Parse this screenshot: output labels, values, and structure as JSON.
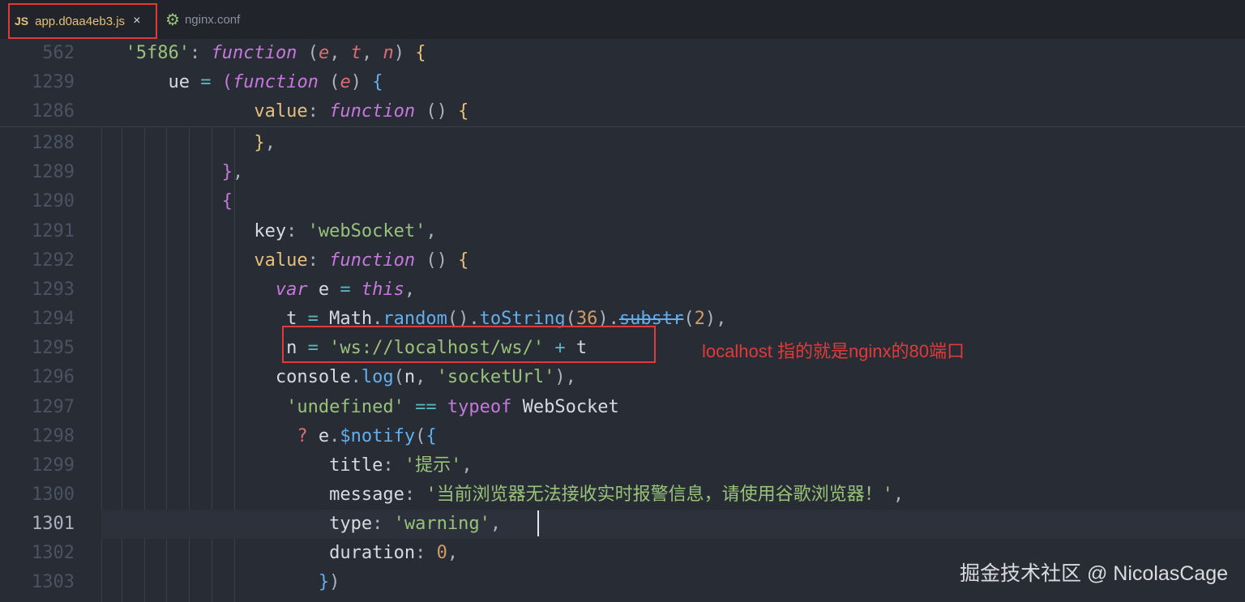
{
  "tabs": [
    {
      "icon": "JS",
      "label": "app.d0aa4eb3.js",
      "close": "×"
    },
    {
      "icon": "gear",
      "label": "nginx.conf"
    }
  ],
  "lines": [
    {
      "num": "562",
      "code": [
        [
          "s",
          "  '5f86'"
        ],
        [
          "p",
          ": "
        ],
        [
          "k",
          "function"
        ],
        [
          "p",
          " ("
        ],
        [
          "v",
          "e"
        ],
        [
          "p",
          ", "
        ],
        [
          "v",
          "t"
        ],
        [
          "p",
          ", "
        ],
        [
          "v",
          "n"
        ],
        [
          "p",
          ") "
        ],
        [
          "br1",
          "{"
        ]
      ]
    },
    {
      "num": "1239",
      "code": [
        [
          "id",
          "      ue "
        ],
        [
          "op",
          "="
        ],
        [
          "p",
          " "
        ],
        [
          "br2",
          "("
        ],
        [
          "k",
          "function"
        ],
        [
          "p",
          " ("
        ],
        [
          "v",
          "e"
        ],
        [
          "p",
          ") "
        ],
        [
          "br3",
          "{"
        ]
      ]
    },
    {
      "num": "1286",
      "code": [
        [
          "pr",
          "              value"
        ],
        [
          "p",
          ": "
        ],
        [
          "k",
          "function"
        ],
        [
          "p",
          " () "
        ],
        [
          "br1",
          "{"
        ]
      ]
    },
    {
      "num": "1288",
      "code": [
        [
          "br1",
          "              }"
        ],
        [
          "p",
          ","
        ]
      ]
    },
    {
      "num": "1289",
      "code": [
        [
          "br2",
          "           }"
        ],
        [
          "p",
          ","
        ]
      ]
    },
    {
      "num": "1290",
      "code": [
        [
          "br2",
          "           {"
        ]
      ]
    },
    {
      "num": "1291",
      "code": [
        [
          "id",
          "              key"
        ],
        [
          "p",
          ": "
        ],
        [
          "s",
          "'webSocket'"
        ],
        [
          "p",
          ","
        ]
      ]
    },
    {
      "num": "1292",
      "code": [
        [
          "pr",
          "              value"
        ],
        [
          "p",
          ": "
        ],
        [
          "k",
          "function"
        ],
        [
          "p",
          " () "
        ],
        [
          "br1",
          "{"
        ]
      ]
    },
    {
      "num": "1293",
      "code": [
        [
          "k",
          "                var"
        ],
        [
          "id",
          " e "
        ],
        [
          "op",
          "="
        ],
        [
          "k",
          " this"
        ],
        [
          "p",
          ","
        ]
      ]
    },
    {
      "num": "1294",
      "code": [
        [
          "id",
          "                 t "
        ],
        [
          "op",
          "="
        ],
        [
          "id",
          " Math"
        ],
        [
          "p",
          "."
        ],
        [
          "f",
          "random"
        ],
        [
          "p",
          "()."
        ],
        [
          "f",
          "toString"
        ],
        [
          "p",
          "("
        ],
        [
          "n",
          "36"
        ],
        [
          "p",
          ")."
        ],
        [
          "f strike",
          "substr"
        ],
        [
          "p",
          "("
        ],
        [
          "n",
          "2"
        ],
        [
          "p",
          "),"
        ]
      ]
    },
    {
      "num": "1295",
      "code": [
        [
          "id",
          "                 n "
        ],
        [
          "op",
          "="
        ],
        [
          "p",
          " "
        ],
        [
          "s",
          "'ws://localhost/ws/'"
        ],
        [
          "p",
          " "
        ],
        [
          "op",
          "+"
        ],
        [
          "id",
          " t"
        ]
      ]
    },
    {
      "num": "1296",
      "code": [
        [
          "id",
          "                console"
        ],
        [
          "p",
          "."
        ],
        [
          "f",
          "log"
        ],
        [
          "p",
          "("
        ],
        [
          "id",
          "n"
        ],
        [
          "p",
          ", "
        ],
        [
          "s",
          "'socketUrl'"
        ],
        [
          "p",
          "),"
        ]
      ]
    },
    {
      "num": "1297",
      "code": [
        [
          "s",
          "                 'undefined'"
        ],
        [
          "op",
          " == "
        ],
        [
          "kw",
          "typeof"
        ],
        [
          "id",
          " WebSocket"
        ]
      ]
    },
    {
      "num": "1298",
      "code": [
        [
          "orange",
          "                  ? "
        ],
        [
          "id",
          "e"
        ],
        [
          "p",
          "."
        ],
        [
          "f",
          "$notify"
        ],
        [
          "p",
          "("
        ],
        [
          "br3",
          "{"
        ]
      ]
    },
    {
      "num": "1299",
      "code": [
        [
          "id",
          "                     title"
        ],
        [
          "p",
          ": "
        ],
        [
          "s",
          "'提示'"
        ],
        [
          "p",
          ","
        ]
      ]
    },
    {
      "num": "1300",
      "code": [
        [
          "id",
          "                     message"
        ],
        [
          "p",
          ": "
        ],
        [
          "s",
          "'当前浏览器无法接收实时报警信息，请使用谷歌浏览器！'"
        ],
        [
          "p",
          ","
        ]
      ]
    },
    {
      "num": "1301",
      "code": [
        [
          "id",
          "                     type"
        ],
        [
          "p",
          ": "
        ],
        [
          "s",
          "'warning'"
        ],
        [
          "p",
          ","
        ]
      ]
    },
    {
      "num": "1302",
      "code": [
        [
          "id",
          "                     duration"
        ],
        [
          "p",
          ": "
        ],
        [
          "n",
          "0"
        ],
        [
          "p",
          ","
        ]
      ]
    },
    {
      "num": "1303",
      "code": [
        [
          "br3",
          "                    }"
        ],
        [
          "p",
          ")"
        ]
      ]
    }
  ],
  "current_line": "1301",
  "annotation": "localhost 指的就是nginx的80端口",
  "watermark": "掘金技术社区 @ NicolasCage",
  "colors": {
    "highlight": "#e03b3b",
    "background": "#282c34"
  }
}
